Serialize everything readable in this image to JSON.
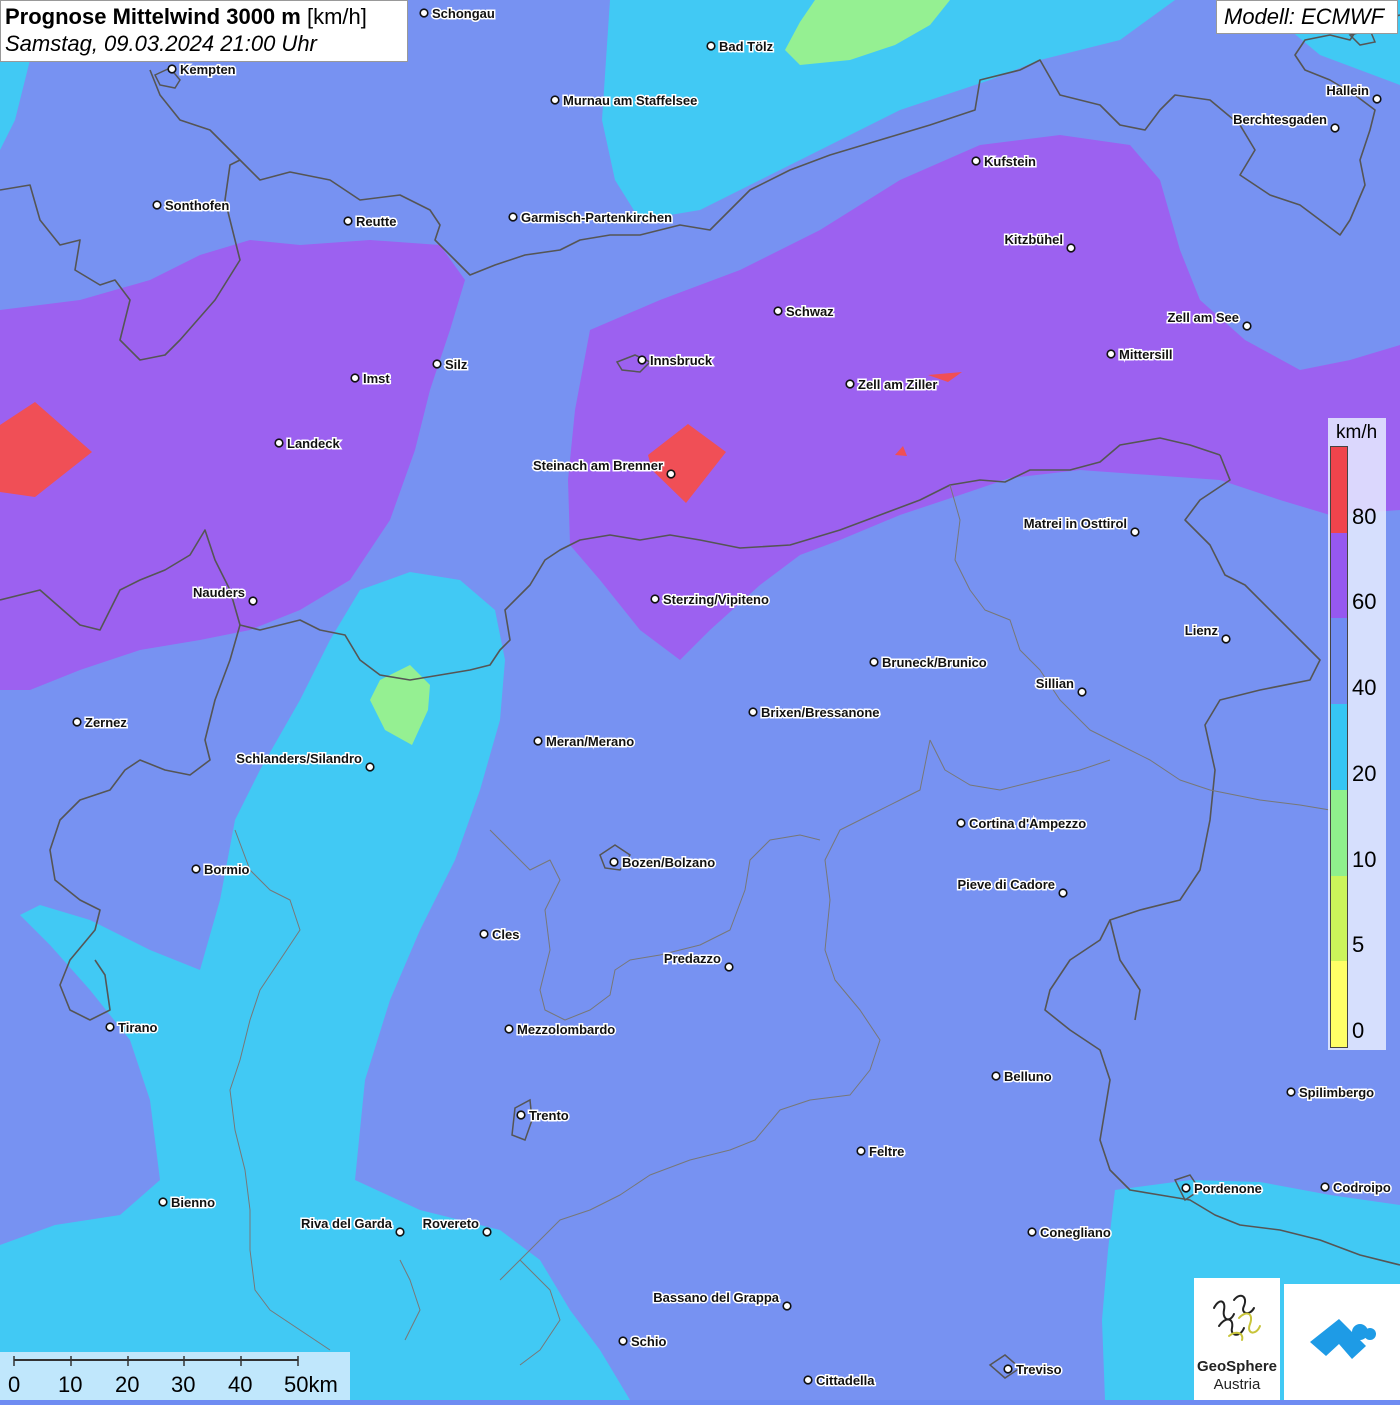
{
  "header": {
    "title": "Prognose Mittelwind 3000 m",
    "unit": "[km/h]",
    "subtitle": "Samstag, 09.03.2024 21:00 Uhr"
  },
  "model_label": "Modell: ECMWF",
  "legend": {
    "unit": "km/h",
    "classes": [
      {
        "from": 0,
        "to": 5,
        "color": "#ffff66"
      },
      {
        "from": 5,
        "to": 10,
        "color": "#ccf55a"
      },
      {
        "from": 10,
        "to": 20,
        "color": "#8ff08c"
      },
      {
        "from": 20,
        "to": 40,
        "color": "#36c6f4"
      },
      {
        "from": 40,
        "to": 60,
        "color": "#6f8cf2"
      },
      {
        "from": 60,
        "to": 80,
        "color": "#9658f0"
      },
      {
        "from": 80,
        "to": 100,
        "color": "#f0444c"
      }
    ],
    "labels": [
      "0",
      "5",
      "10",
      "20",
      "40",
      "60",
      "80"
    ]
  },
  "scale_bar": {
    "labels": [
      "0",
      "10",
      "20",
      "30",
      "40",
      "50km"
    ]
  },
  "cities": [
    {
      "name": "Schongau"
    },
    {
      "name": "Bad Tölz"
    },
    {
      "name": "Kempten"
    },
    {
      "name": "Murnau am Staffelsee"
    },
    {
      "name": "Hallein"
    },
    {
      "name": "Berchtesgaden"
    },
    {
      "name": "Kufstein"
    },
    {
      "name": "Sonthofen"
    },
    {
      "name": "Reutte"
    },
    {
      "name": "Garmisch-Partenkirchen"
    },
    {
      "name": "Kitzbühel"
    },
    {
      "name": "Schwaz"
    },
    {
      "name": "Zell am See"
    },
    {
      "name": "Mittersill"
    },
    {
      "name": "Innsbruck"
    },
    {
      "name": "Silz"
    },
    {
      "name": "Imst"
    },
    {
      "name": "Zell am Ziller"
    },
    {
      "name": "Landeck"
    },
    {
      "name": "Steinach am Brenner"
    },
    {
      "name": "Matrei in Osttirol"
    },
    {
      "name": "Nauders"
    },
    {
      "name": "Sterzing/Vipiteno"
    },
    {
      "name": "Lienz"
    },
    {
      "name": "Bruneck/Brunico"
    },
    {
      "name": "Sillian"
    },
    {
      "name": "Brixen/Bressanone"
    },
    {
      "name": "Zernez"
    },
    {
      "name": "Meran/Merano"
    },
    {
      "name": "Schlanders/Silandro"
    },
    {
      "name": "Cortina d'Ampezzo"
    },
    {
      "name": "Bozen/Bolzano"
    },
    {
      "name": "Bormio"
    },
    {
      "name": "Pieve di Cadore"
    },
    {
      "name": "Cles"
    },
    {
      "name": "Predazzo"
    },
    {
      "name": "Tirano"
    },
    {
      "name": "Mezzolombardo"
    },
    {
      "name": "Belluno"
    },
    {
      "name": "Spilimbergo"
    },
    {
      "name": "Trento"
    },
    {
      "name": "Feltre"
    },
    {
      "name": "Pordenone"
    },
    {
      "name": "Codroipo"
    },
    {
      "name": "Bienno"
    },
    {
      "name": "Riva del Garda"
    },
    {
      "name": "Rovereto"
    },
    {
      "name": "Conegliano"
    },
    {
      "name": "Bassano del Grappa"
    },
    {
      "name": "Schio"
    },
    {
      "name": "Treviso"
    },
    {
      "name": "Cittadella"
    }
  ],
  "logos": {
    "geosphere_line1": "GeoSphere",
    "geosphere_line2": "Austria"
  }
}
